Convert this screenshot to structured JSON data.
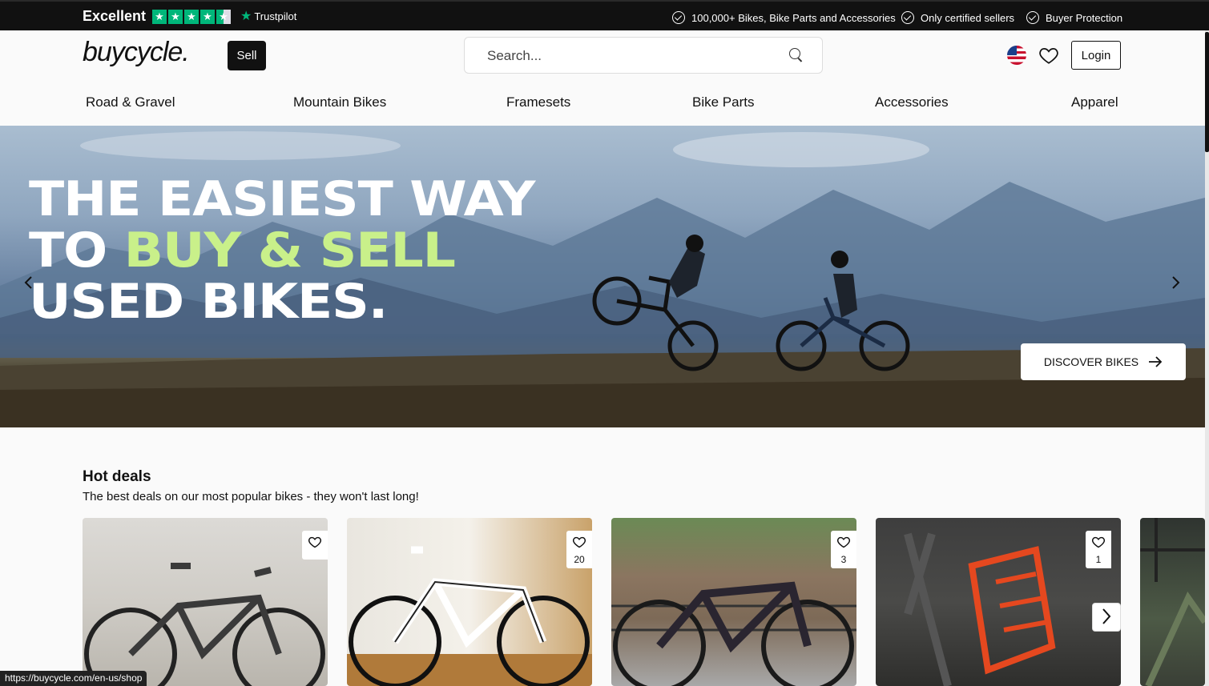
{
  "topbar": {
    "rating_label": "Excellent",
    "rating_stars": 4.5,
    "brand": "Trustpilot",
    "usps": [
      "100,000+ Bikes, Bike Parts and Accessories",
      "Only certified sellers",
      "Buyer Protection"
    ]
  },
  "header": {
    "logo": "buycycle.",
    "sell_label": "Sell",
    "search_placeholder": "Search...",
    "login_label": "Login",
    "icons": [
      "search-icon",
      "us-flag-icon",
      "heart-icon"
    ]
  },
  "nav": {
    "items": [
      "Road & Gravel",
      "Mountain Bikes",
      "Framesets",
      "Bike Parts",
      "Accessories",
      "Apparel"
    ]
  },
  "hero": {
    "line1": "THE EASIEST WAY",
    "line2_prefix": "TO ",
    "line2_accent": "BUY & SELL",
    "line3": "USED BIKES.",
    "cta_label": "DISCOVER BIKES",
    "accent_color": "#c9f08a"
  },
  "hot_deals": {
    "title": "Hot deals",
    "subtitle": "The best deals on our most popular bikes - they won't last long!",
    "cards": [
      {
        "favorites": ""
      },
      {
        "favorites": "20"
      },
      {
        "favorites": "3"
      },
      {
        "favorites": "1"
      }
    ]
  },
  "status_bar": {
    "url": "https://buycycle.com/en-us/shop"
  },
  "colors": {
    "trustpilot_green": "#00b67a",
    "dark": "#111111"
  }
}
